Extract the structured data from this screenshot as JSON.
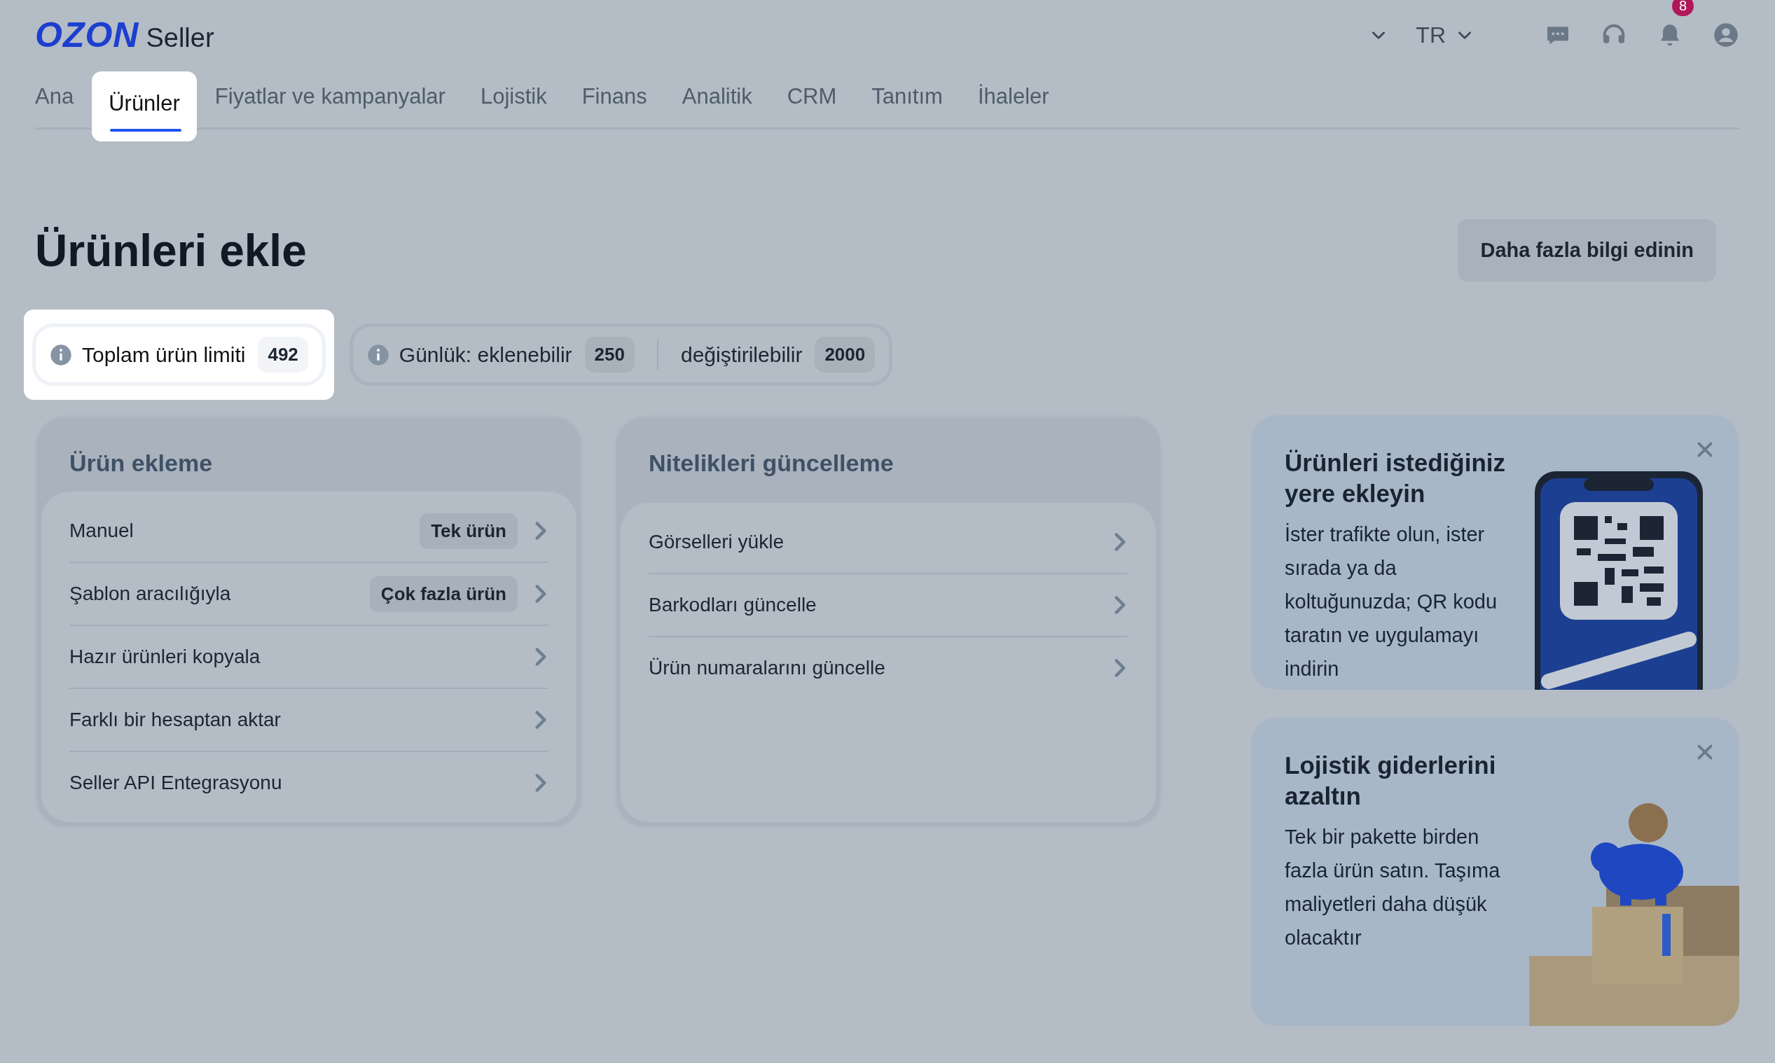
{
  "header": {
    "logo": "OZON",
    "logo_suffix": "Seller",
    "language": "TR",
    "notification_count": "8"
  },
  "tabs": [
    {
      "label": "Ana",
      "selected": false
    },
    {
      "label": "Ürünler",
      "selected": true
    },
    {
      "label": "Fiyatlar ve kampanyalar",
      "selected": false
    },
    {
      "label": "Lojistik",
      "selected": false
    },
    {
      "label": "Finans",
      "selected": false
    },
    {
      "label": "Analitik",
      "selected": false
    },
    {
      "label": "CRM",
      "selected": false
    },
    {
      "label": "Tanıtım",
      "selected": false
    },
    {
      "label": "İhaleler",
      "selected": false
    }
  ],
  "page": {
    "title": "Ürünleri ekle",
    "info_button": "Daha fazla bilgi edinin"
  },
  "limit_groups": [
    {
      "highlighted": true,
      "items": [
        {
          "label": "Toplam ürün limiti",
          "value": "492"
        }
      ]
    },
    {
      "highlighted": false,
      "items": [
        {
          "label": "Günlük: eklenebilir",
          "value": "250"
        },
        {
          "label": "değiştirilebilir",
          "value": "2000"
        }
      ]
    }
  ],
  "sections": [
    {
      "title": "Ürün ekleme",
      "rows": [
        {
          "label": "Manuel",
          "tag": "Tek ürün"
        },
        {
          "label": "Şablon aracılığıyla",
          "tag": "Çok fazla ürün"
        },
        {
          "label": "Hazır ürünleri kopyala"
        },
        {
          "label": "Farklı bir hesaptan aktar"
        },
        {
          "label": "Seller API Entegrasyonu"
        }
      ]
    },
    {
      "title": "Nitelikleri güncelleme",
      "rows": [
        {
          "label": "Görselleri yükle"
        },
        {
          "label": "Barkodları güncelle"
        },
        {
          "label": "Ürün numaralarını güncelle"
        }
      ]
    }
  ],
  "promos": [
    {
      "kind": "qr",
      "title": "Ürünleri istediğiniz yere ekleyin",
      "text": "İster trafikte olun, ister sırada ya da koltuğunuzda; QR kodu taratın ve uygulamayı indirin"
    },
    {
      "kind": "logistics",
      "title": "Lojistik giderlerini azaltın",
      "text": "Tek bir pakette birden fazla ürün satın. Taşıma maliyetleri daha düşük olacaktır"
    }
  ]
}
